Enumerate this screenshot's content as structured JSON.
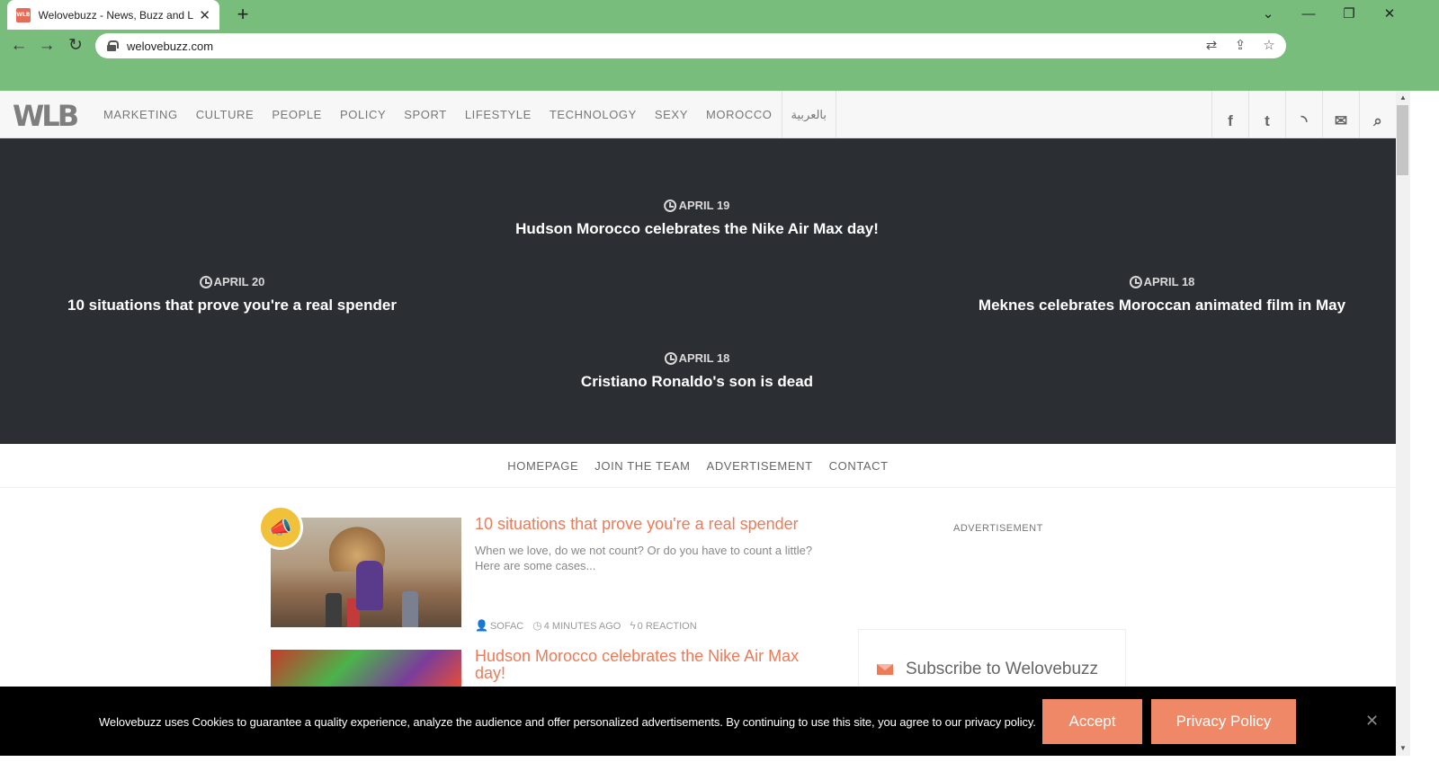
{
  "browser": {
    "tab_title": "Welovebuzz - News, Buzz and LOL",
    "favicon_text": "WLB",
    "new_tab": "+",
    "url": "welovebuzz.com",
    "controls": {
      "minimize": "—",
      "restore": "❐",
      "close": "✕",
      "tab_list": "⌄"
    }
  },
  "site": {
    "logo": "WLB",
    "nav": [
      "MARKETING",
      "CULTURE",
      "PEOPLE",
      "POLICY",
      "SPORT",
      "LIFESTYLE",
      "TECHNOLOGY",
      "SEXY",
      "MOROCCO"
    ],
    "nav_arabic": "بالعربية",
    "social_icons": [
      "facebook-icon",
      "twitter-icon",
      "rss-icon",
      "mail-icon",
      "search-icon"
    ]
  },
  "ticker": [
    {
      "date": "APRIL 19",
      "title": "Hudson Morocco celebrates the Nike Air Max day!"
    },
    {
      "date": "APRIL 20",
      "title": "10 situations that prove you're a real spender"
    },
    {
      "date": "APRIL 18",
      "title": "Meknes celebrates Moroccan animated film in May"
    },
    {
      "date": "APRIL 18",
      "title": "Cristiano Ronaldo's son is dead"
    }
  ],
  "sub_nav": [
    "HOMEPAGE",
    "JOIN THE TEAM",
    "ADVERTISEMENT",
    "CONTACT"
  ],
  "articles": [
    {
      "title": "10 situations that prove you're a real spender",
      "excerpt": "When we love, do we not count? Or do you have to count a little? Here are some cases...",
      "author": "SOFAC",
      "time": "4 MINUTES AGO",
      "reactions": "0 REACTION"
    },
    {
      "title": "Hudson Morocco celebrates the Nike Air Max day!"
    }
  ],
  "sidebar": {
    "ad_label": "ADVERTISEMENT",
    "subscribe_title": "Subscribe to Welovebuzz"
  },
  "cookie": {
    "text": "Welovebuzz uses Cookies to guarantee a quality experience, analyze the audience and offer personalized advertisements. By continuing to use this site, you agree to our privacy policy.",
    "accept": "Accept",
    "privacy": "Privacy Policy",
    "close": "✕"
  },
  "colors": {
    "browser_frame": "#79bd7d",
    "ticker_bg": "#2b2f34",
    "accent": "#ee7a57",
    "cookie_btn": "#ee8866"
  }
}
